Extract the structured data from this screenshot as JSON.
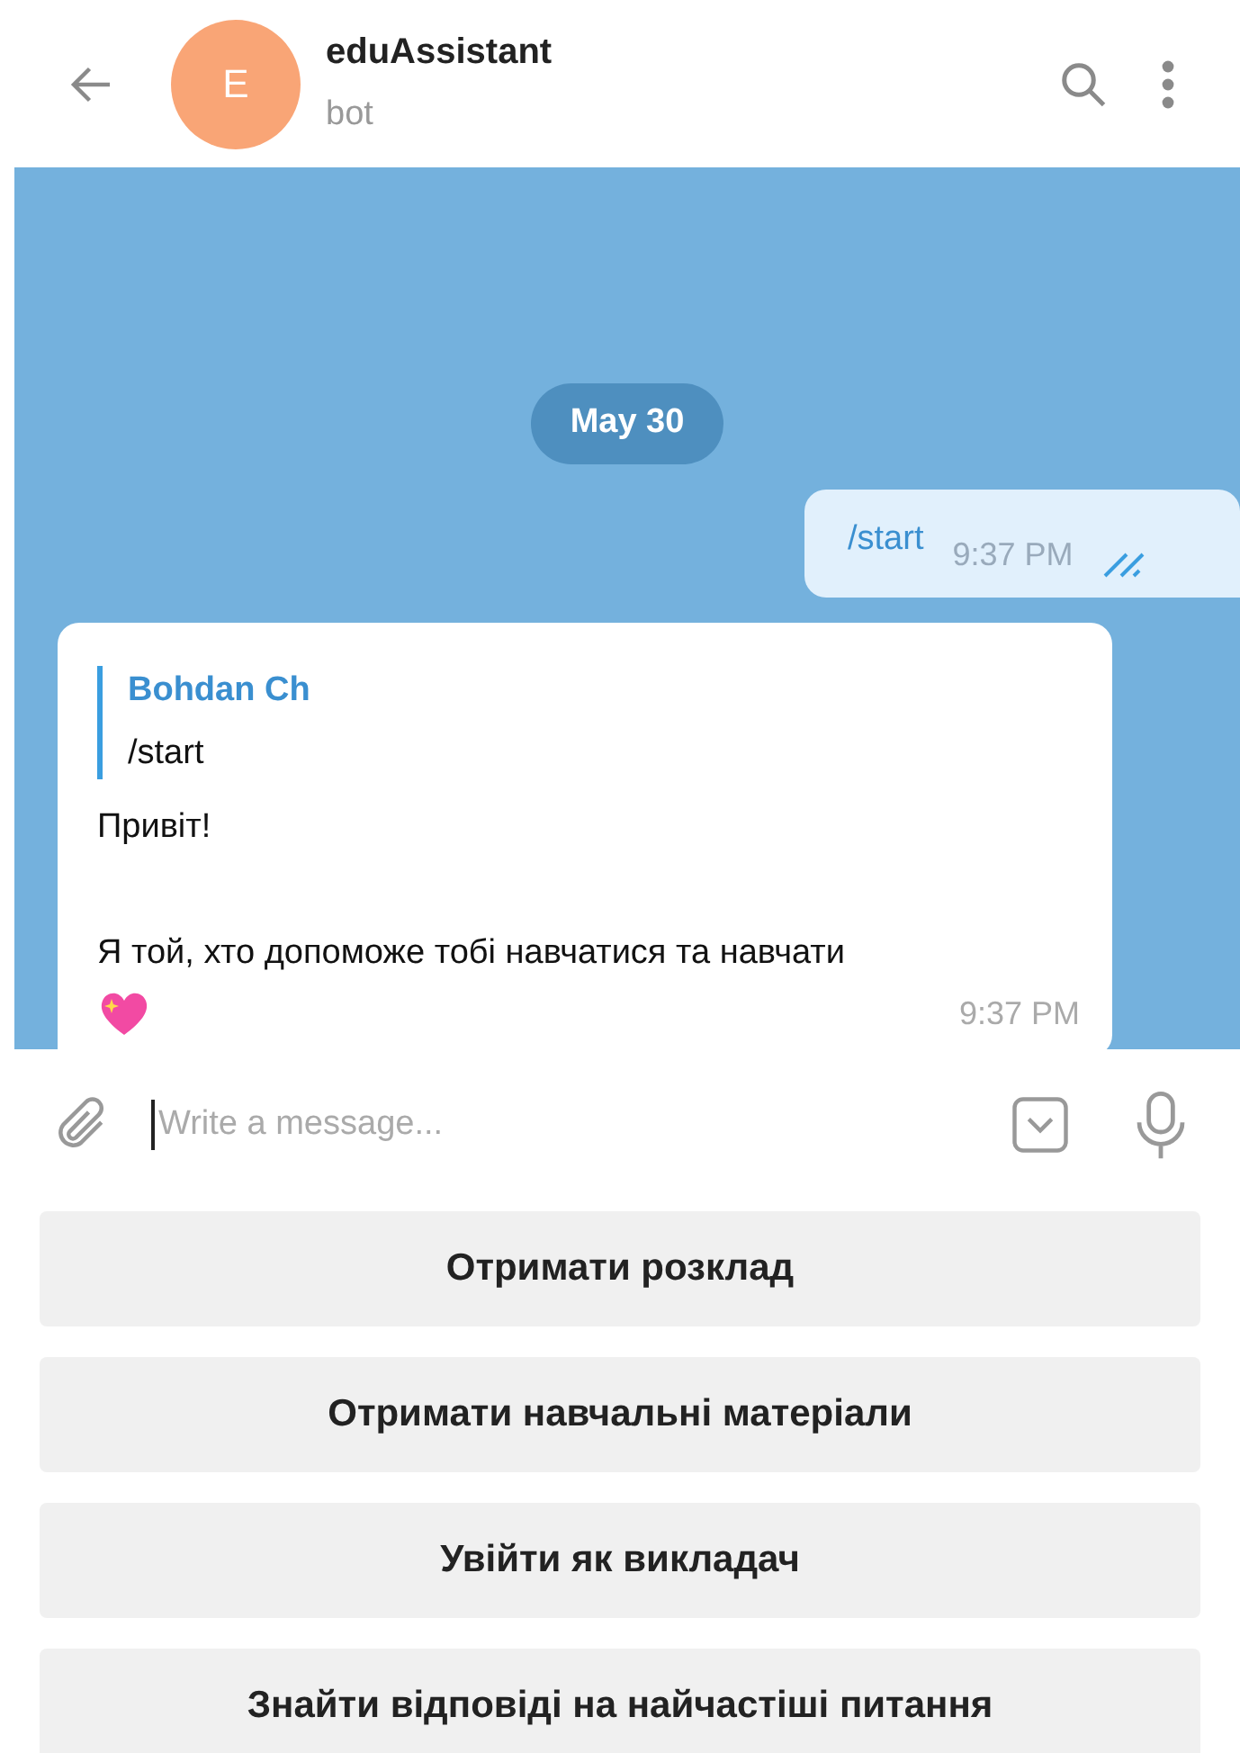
{
  "header": {
    "avatar_letter": "E",
    "title": "eduAssistant",
    "subtitle": "bot"
  },
  "chat": {
    "date": "May 30",
    "messages": [
      {
        "kind": "outgoing",
        "text": "/start",
        "time": "9:37 PM",
        "read": true
      },
      {
        "kind": "incoming",
        "reply_author": "Bohdan Ch",
        "reply_text": "/start",
        "lines": [
          "Привіт!",
          "Я той, хто допоможе тобі навчатися та навчати"
        ],
        "time": "9:37 PM"
      }
    ]
  },
  "composer": {
    "placeholder": "Write a message..."
  },
  "keyboard": [
    "Отримати розклад",
    "Отримати навчальні матеріали",
    "Увійти як викладач",
    "Знайти відповіді на найчастіші питання"
  ]
}
